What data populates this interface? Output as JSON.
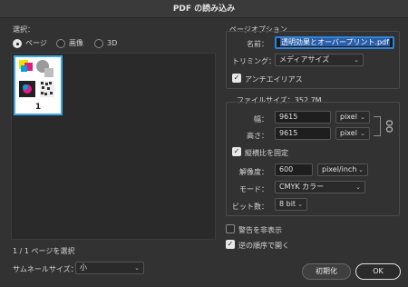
{
  "window": {
    "title": "PDF の読み込み"
  },
  "left": {
    "section_label": "選択：",
    "radios": [
      {
        "label": "ページ",
        "selected": true
      },
      {
        "label": "画像",
        "selected": false
      },
      {
        "label": "3D",
        "selected": false
      }
    ],
    "thumbnail": {
      "page_number": "1"
    },
    "status": "1 / 1 ページを選択",
    "thumb_size_label": "サムネールサイズ：",
    "thumb_size_value": "小"
  },
  "page_options": {
    "title": "ページオプション",
    "name_label": "名前：",
    "name_value": "透明効果とオーバープリント.pdf",
    "crop_label": "トリミング：",
    "crop_value": "メディアサイズ",
    "antialias_label": "アンチエイリアス",
    "antialias_checked": true
  },
  "image_size": {
    "title": "ファイルサイズ：352.7M",
    "width_label": "幅：",
    "width_value": "9615",
    "width_unit": "pixel",
    "height_label": "高さ：",
    "height_value": "9615",
    "height_unit": "pixel",
    "constrain_label": "縦横比を固定",
    "constrain_checked": true,
    "resolution_label": "解像度：",
    "resolution_value": "600",
    "resolution_unit": "pixel/inch",
    "mode_label": "モード：",
    "mode_value": "CMYK カラー",
    "depth_label": "ビット数：",
    "depth_value": "8 bit"
  },
  "bottom_options": {
    "suppress_warnings_label": "警告を非表示",
    "suppress_warnings_checked": false,
    "reverse_order_label": "逆の順序で開く",
    "reverse_order_checked": true
  },
  "buttons": {
    "reset": "初期化",
    "ok": "OK"
  },
  "icons": {
    "link": "link-icon",
    "chevron": "chevron-down-icon",
    "check": "checkmark-icon"
  },
  "colors": {
    "accent": "#2f84d6",
    "thumb_border": "#3fa9e0"
  }
}
